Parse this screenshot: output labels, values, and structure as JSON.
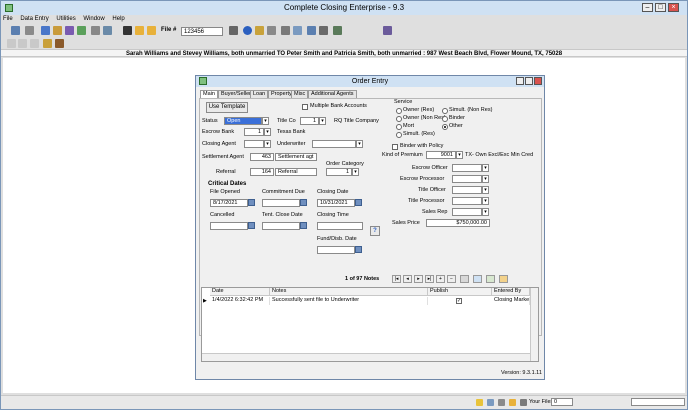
{
  "window": {
    "title": "Complete Closing Enterprise - 9.3"
  },
  "menu": [
    "File",
    "Data Entry",
    "Utilities",
    "Window",
    "Help"
  ],
  "toolbar": {
    "file_label": "File #",
    "file_value": "123456"
  },
  "infobar": "Sarah Williams and Stevey Williams, both unmarried TO Peter Smith and Patricia Smith, both unmarried : 987 West Beach Blvd, Flower Mound, TX, 75028",
  "dialog": {
    "title": "Order Entry",
    "tabs": [
      "Main",
      "Buyer/Seller",
      "Loan",
      "Property",
      "Misc",
      "Additional Agents"
    ],
    "template_button": "Use Template",
    "multi_bank": "Multiple Bank Accounts",
    "status_label": "Status",
    "status_value": "Open",
    "title_co_label": "Title Co",
    "title_co_value": "1",
    "title_co_name": "RQ Title Company",
    "escrow_bank_label": "Escrow Bank",
    "escrow_bank_value": "1",
    "escrow_bank_name": "Texas Bank",
    "closing_agent_label": "Closing Agent",
    "underwriter_label": "Underwriter",
    "settlement_agent_label": "Settlement Agent",
    "settlement_agent_value": "463",
    "settlement_agent_name": "Settlement agt",
    "referral_label": "Referral",
    "referral_value": "164",
    "referral_name": "Referral",
    "order_category_label": "Order Category",
    "order_category_value": "1",
    "service_label": "Service",
    "service_options": [
      "Owner (Res)",
      "Simult. (Non Res)",
      "Owner (Non Res)",
      "Binder",
      "Mort",
      "Other",
      "Simult. (Res)"
    ],
    "binder_policy": "Binder with Policy",
    "kind_premium_label": "Kind of Premium",
    "kind_premium_value": "9001",
    "kind_premium_desc": "TX- Own Excl/Exc Min Cred",
    "officers": [
      "Escrow Officer",
      "Escrow Processor",
      "Title Officer",
      "Title Processor",
      "Sales Rep"
    ],
    "sales_price_label": "Sales Price",
    "sales_price_value": "$750,000.00",
    "critical_dates": "Critical Dates",
    "file_opened_label": "File Opened",
    "file_opened_value": "8/17/2021",
    "commitment_due_label": "Commitment Due",
    "closing_date_label": "Closing Date",
    "closing_date_value": "10/31/2021",
    "cancelled_label": "Cancelled",
    "tent_close_label": "Tent. Close Date",
    "closing_time_label": "Closing Time",
    "fund_date_label": "Fund/Disb. Date",
    "notes_count": "1 of 97 Notes",
    "grid_headers": [
      "Date",
      "Notes",
      "Publish",
      "Entered By"
    ],
    "grid_row": {
      "date": "1/4/2022 6:32:42 PM",
      "note": "Successfully sent file to Underwriter",
      "entered_by": "Closing Market"
    },
    "version": "Version: 9.3.1.11"
  },
  "statusbar": {
    "your_files_label": "Your Files",
    "your_files_value": "0"
  }
}
